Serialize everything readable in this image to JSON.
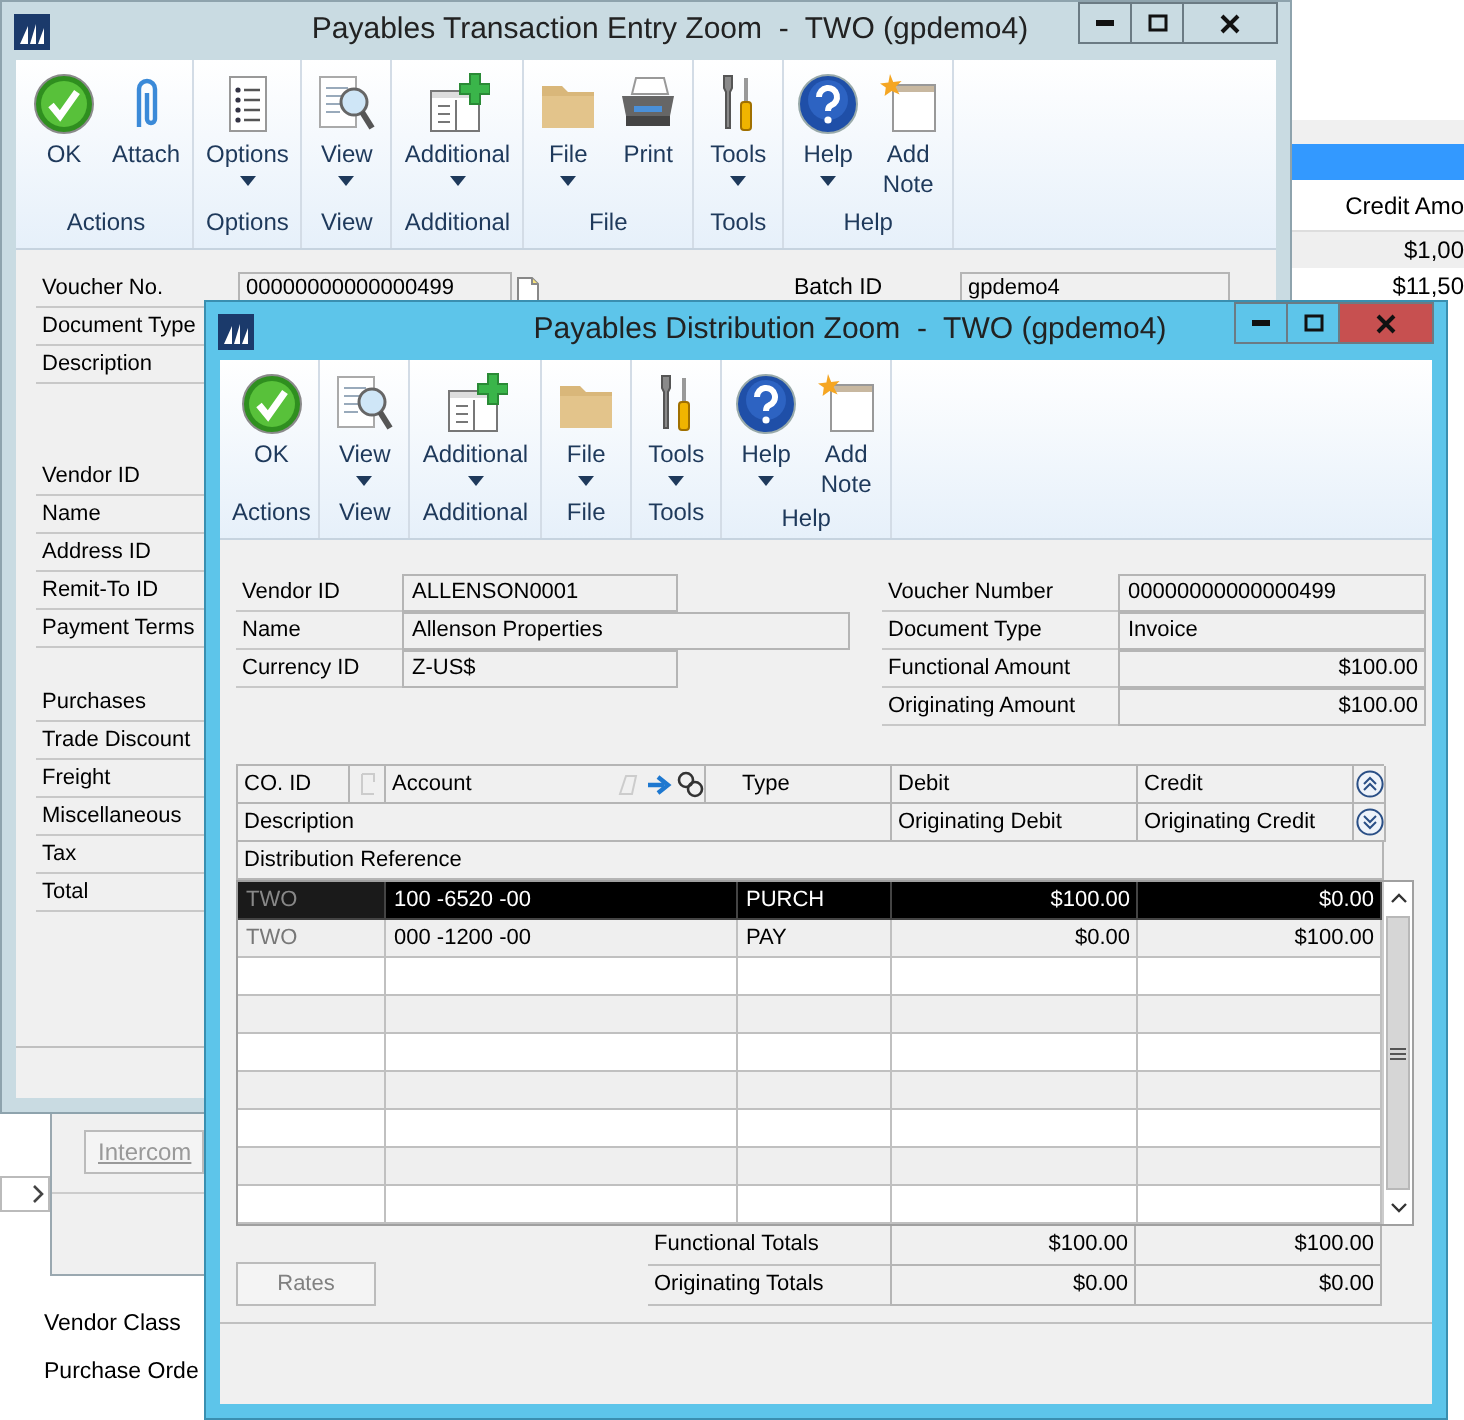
{
  "background": {
    "report_list": {
      "column_header": "Credit Amo",
      "rows": [
        "$1,00",
        "$11,50"
      ]
    },
    "intercompany_button": "Intercom",
    "navigation_items": [
      "Vendor Class",
      "Purchase Orde"
    ]
  },
  "transaction_window": {
    "title": "Payables Transaction Entry Zoom  -  TWO (gpdemo4)",
    "ribbon": [
      {
        "label": "Actions",
        "buttons": [
          {
            "label": "OK",
            "kind": "check",
            "menu": false
          },
          {
            "label": "Attach",
            "kind": "paperclip",
            "menu": false
          }
        ]
      },
      {
        "label": "Options",
        "buttons": [
          {
            "label": "Options",
            "kind": "list",
            "menu": true
          }
        ]
      },
      {
        "label": "View",
        "buttons": [
          {
            "label": "View",
            "kind": "view",
            "menu": true
          }
        ]
      },
      {
        "label": "Additional",
        "buttons": [
          {
            "label": "Additional",
            "kind": "additional",
            "menu": true
          }
        ]
      },
      {
        "label": "File",
        "buttons": [
          {
            "label": "File",
            "kind": "folder",
            "menu": true
          },
          {
            "label": "Print",
            "kind": "printer",
            "menu": false
          }
        ]
      },
      {
        "label": "Tools",
        "buttons": [
          {
            "label": "Tools",
            "kind": "tools",
            "menu": true
          }
        ]
      },
      {
        "label": "Help",
        "buttons": [
          {
            "label": "Help",
            "kind": "help",
            "menu": true
          },
          {
            "label": "Add Note",
            "kind": "note",
            "menu": false
          }
        ]
      }
    ],
    "field_groups": [
      [
        {
          "label": "Voucher No.",
          "value": "00000000000000499"
        },
        {
          "label": "Document Type"
        },
        {
          "label": "Description"
        }
      ],
      [
        {
          "label": "Vendor ID"
        },
        {
          "label": "Name"
        },
        {
          "label": "Address ID"
        },
        {
          "label": "Remit-To ID"
        },
        {
          "label": "Payment Terms"
        }
      ],
      [
        {
          "label": "Purchases"
        },
        {
          "label": "Trade Discount"
        },
        {
          "label": "Freight"
        },
        {
          "label": "Miscellaneous"
        },
        {
          "label": "Tax"
        },
        {
          "label": "Total"
        }
      ]
    ],
    "batch": {
      "label": "Batch ID",
      "value": "gpdemo4"
    }
  },
  "distribution_window": {
    "title": "Payables Distribution Zoom  -  TWO (gpdemo4)",
    "ribbon": [
      {
        "label": "Actions",
        "buttons": [
          {
            "label": "OK",
            "kind": "check",
            "menu": false
          }
        ]
      },
      {
        "label": "View",
        "buttons": [
          {
            "label": "View",
            "kind": "view",
            "menu": true
          }
        ]
      },
      {
        "label": "Additional",
        "buttons": [
          {
            "label": "Additional",
            "kind": "additional",
            "menu": true
          }
        ]
      },
      {
        "label": "File",
        "buttons": [
          {
            "label": "File",
            "kind": "folder",
            "menu": true
          }
        ]
      },
      {
        "label": "Tools",
        "buttons": [
          {
            "label": "Tools",
            "kind": "tools",
            "menu": true
          }
        ]
      },
      {
        "label": "Help",
        "buttons": [
          {
            "label": "Help",
            "kind": "help",
            "menu": true
          },
          {
            "label": "Add Note",
            "kind": "note",
            "menu": false
          }
        ]
      }
    ],
    "vendor_fields": [
      {
        "label": "Vendor ID",
        "value": "ALLENSON0001",
        "kind": "short"
      },
      {
        "label": "Name",
        "value": "Allenson Properties",
        "kind": "long"
      },
      {
        "label": "Currency ID",
        "value": "Z-US$",
        "kind": "short"
      }
    ],
    "document_fields": [
      {
        "label": "Voucher Number",
        "value": "00000000000000499",
        "kind": "text"
      },
      {
        "label": "Document Type",
        "value": "Invoice",
        "kind": "text"
      },
      {
        "label": "Functional Amount",
        "value": "$100.00",
        "kind": "amount"
      },
      {
        "label": "Originating Amount",
        "value": "$100.00",
        "kind": "amount"
      }
    ],
    "grid": {
      "header_row_1": [
        "CO. ID",
        "Account",
        "Type",
        "Debit",
        "Credit"
      ],
      "header_row_2": [
        "Description",
        "Originating Debit",
        "Originating Credit"
      ],
      "header_row_3": [
        "Distribution Reference"
      ],
      "rows": [
        {
          "co_id": "TWO",
          "account": "100 -6520 -00",
          "type": "PURCH",
          "debit": "$100.00",
          "credit": "$0.00",
          "selected": true
        },
        {
          "co_id": "TWO",
          "account": "000 -1200 -00",
          "type": "PAY",
          "debit": "$0.00",
          "credit": "$100.00",
          "selected": false
        }
      ]
    },
    "totals": [
      {
        "label": "Functional Totals",
        "debit": "$100.00",
        "credit": "$100.00"
      },
      {
        "label": "Originating Totals",
        "debit": "$0.00",
        "credit": "$0.00"
      }
    ],
    "rates_button": {
      "label": "Rates",
      "disabled": true
    }
  }
}
